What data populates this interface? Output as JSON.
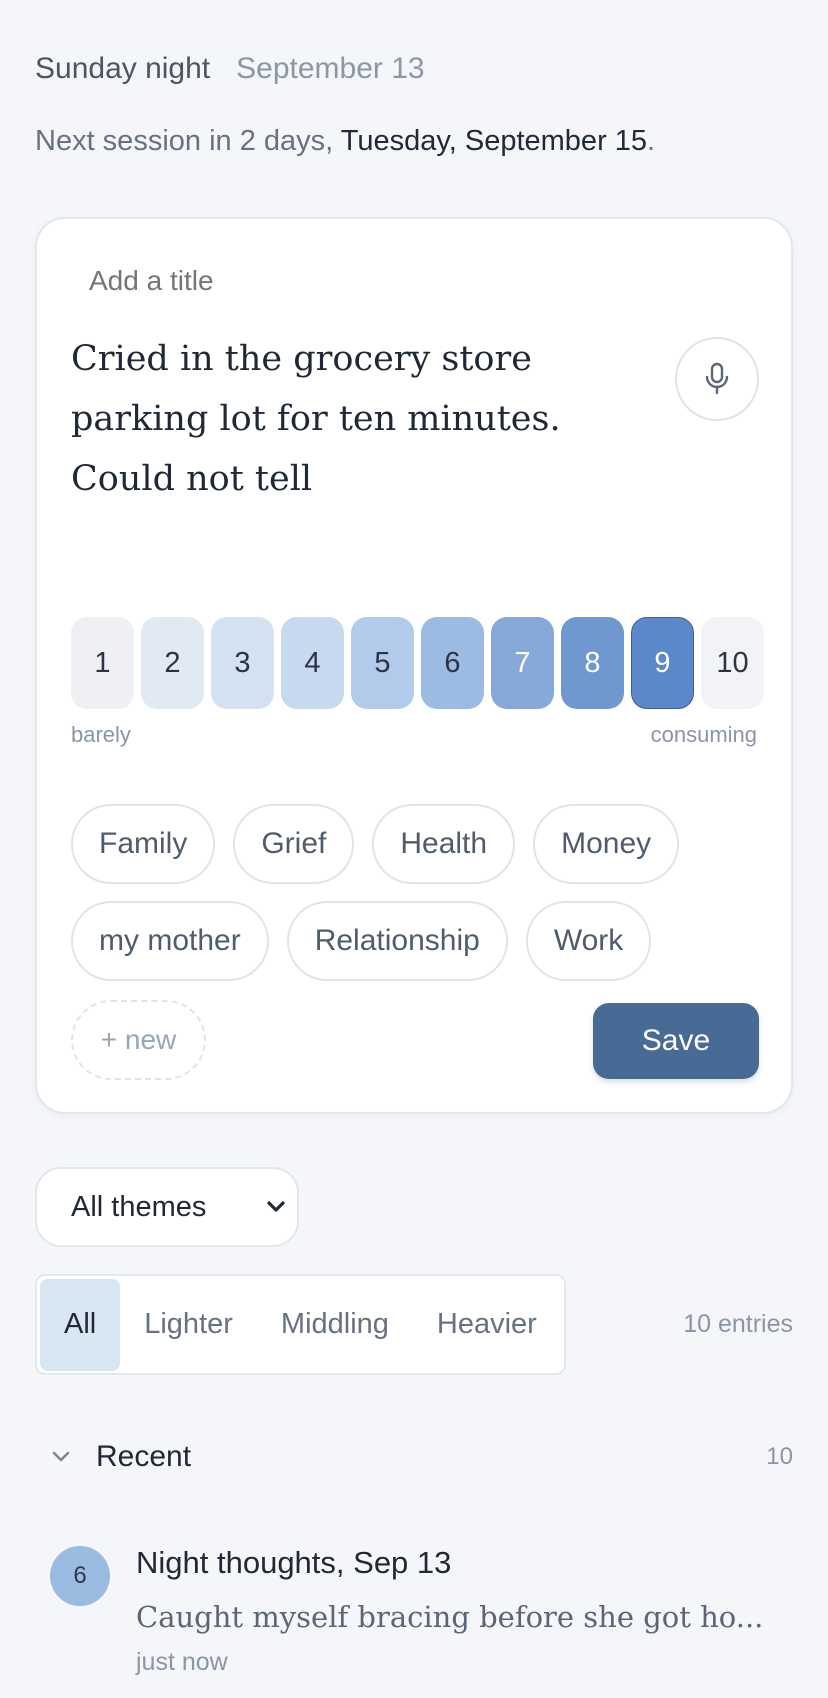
{
  "header": {
    "day": "Sunday night",
    "date": "September 13"
  },
  "next_session": {
    "prefix": "Next session in 2 days,",
    "date": "Tuesday, September 15",
    "suffix": "."
  },
  "composer": {
    "title_placeholder": "Add a title",
    "body": "Cried in the grocery store parking lot for ten minutes. Could not tell",
    "mic_icon": "microphone-icon",
    "scale": {
      "values": [
        "1",
        "2",
        "3",
        "4",
        "5",
        "6",
        "7",
        "8",
        "9",
        "10"
      ],
      "selected": 9,
      "low_label": "barely",
      "high_label": "consuming",
      "colors": [
        "#eef0f4",
        "#e1e9f3",
        "#d4e1f0",
        "#c6d9ee",
        "#b3cbea",
        "#9cbbe2",
        "#86a9da",
        "#6f98d1",
        "#5a88cb",
        "#f2f3f6"
      ]
    },
    "tags_row1": [
      "Family",
      "Grief",
      "Health",
      "Money"
    ],
    "tags_row2": [
      "my mother",
      "Relationship",
      "Work"
    ],
    "new_tag_label": "+ new",
    "save_label": "Save",
    "accent": "#476b94"
  },
  "filters": {
    "theme_select": "All themes",
    "segments": [
      "All",
      "Lighter",
      "Middling",
      "Heavier"
    ],
    "active_segment": "All",
    "entries_count": "10 entries"
  },
  "recent": {
    "title": "Recent",
    "count": "10",
    "entries": [
      {
        "weight": "6",
        "title": "Night thoughts, Sep 13",
        "preview": "Caught myself bracing before she got ho...",
        "time": "just now"
      }
    ]
  }
}
